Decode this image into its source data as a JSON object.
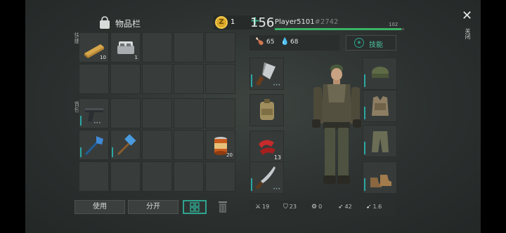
{
  "inventory": {
    "title": "物品栏",
    "coins": "1",
    "add": "+",
    "coin_symbol": "Z",
    "section_labels": [
      "快捷",
      "背包"
    ],
    "quick_slots": [
      {
        "item": "wood-plank",
        "count": "10"
      },
      {
        "item": "metal-ingot",
        "count": "1"
      },
      {},
      {},
      {},
      {},
      {},
      {},
      {},
      {}
    ],
    "backpack_slots": [
      {
        "item": "pistol",
        "durability": true
      },
      {},
      {},
      {},
      {},
      {
        "item": "blue-shovel",
        "durability": true
      },
      {
        "item": "blue-hammer",
        "durability": true
      },
      {},
      {},
      {
        "item": "canned-food",
        "count": "20"
      },
      {},
      {},
      {},
      {},
      {}
    ],
    "buttons": {
      "use": "使用",
      "split": "分开"
    }
  },
  "player": {
    "level": "156",
    "name": "Player5101",
    "tag": "#2742",
    "xp_value": "102",
    "xp_fraction": 0.98,
    "food": "65",
    "water": "68",
    "skills_label": "技能"
  },
  "equipment": {
    "weapon1": {
      "item": "cleaver",
      "durability": true
    },
    "backpack": {
      "item": "khaki-backpack"
    },
    "misc": {
      "item": "red-bandage",
      "count": "13"
    },
    "weapon2": {
      "item": "machete",
      "durability": true
    },
    "head": {
      "item": "green-cap",
      "durability": true
    },
    "body": {
      "item": "camo-vest",
      "durability": true
    },
    "legs": {
      "item": "camo-pants",
      "durability": true
    },
    "feet": {
      "item": "brown-boots",
      "durability": true
    }
  },
  "bottom_stats": [
    {
      "icon": "sword-icon",
      "glyph": "⚔",
      "value": "19"
    },
    {
      "icon": "shield-icon",
      "glyph": "⛉",
      "value": "23"
    },
    {
      "icon": "gear-icon",
      "glyph": "⚙",
      "value": "0"
    },
    {
      "icon": "run-icon",
      "glyph": "➶",
      "value": "42"
    },
    {
      "icon": "speed-icon",
      "glyph": "➹",
      "value": "1.6"
    }
  ],
  "close": {
    "label": "关闭"
  },
  "colors": {
    "accent": "#2fa38d",
    "xp": "#3ab366",
    "coin": "#d9a828"
  }
}
